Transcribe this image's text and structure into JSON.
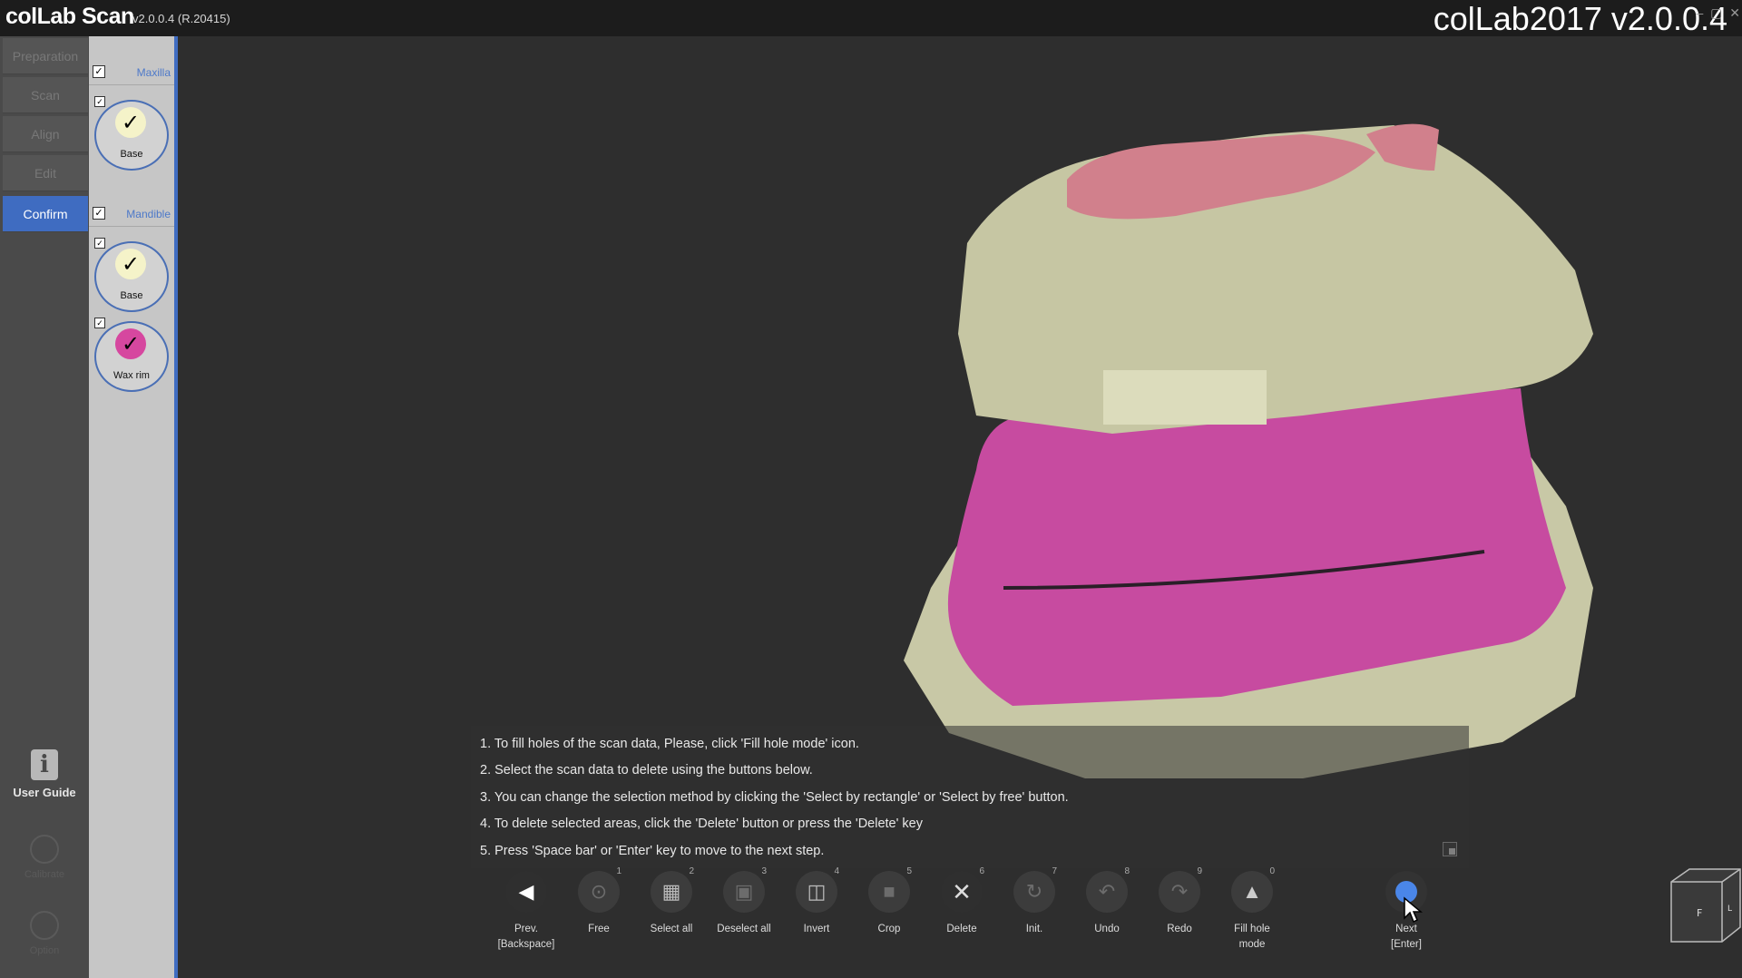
{
  "titlebar": {
    "app_name": "colLab Scan",
    "version": "v2.0.0.4 (R.20415)",
    "overlay_title": "colLab2017 v2.0.0.4",
    "controls": {
      "minimize": "–",
      "maximize": "▢",
      "close": "✕"
    }
  },
  "steps": [
    {
      "label": "Preparation",
      "state": "disabled"
    },
    {
      "label": "Scan",
      "state": "disabled"
    },
    {
      "label": "Align",
      "state": "disabled"
    },
    {
      "label": "Edit",
      "state": "disabled"
    },
    {
      "label": "Confirm",
      "state": "active"
    }
  ],
  "side_tools": {
    "user_guide": "User Guide",
    "calibrate": "Calibrate",
    "options": "Option"
  },
  "data_panel": {
    "maxilla": {
      "label": "Maxilla",
      "checked": true,
      "items": [
        {
          "label": "Base",
          "checked": true,
          "color": "#f5f3c9"
        }
      ]
    },
    "mandible": {
      "label": "Mandible",
      "checked": true,
      "items": [
        {
          "label": "Base",
          "checked": true,
          "color": "#f5f3c9"
        },
        {
          "label": "Wax rim",
          "checked": true,
          "color": "#d6479f"
        }
      ]
    }
  },
  "instructions": [
    "1. To fill holes of the scan data, Please, click 'Fill hole mode' icon.",
    "2. Select the scan data to delete using the buttons below.",
    "3. You can change the selection method by clicking the 'Select by rectangle' or 'Select by free' button.",
    "4. To delete selected areas, click the 'Delete' button or press the 'Delete' key",
    "5. Press 'Space bar' or 'Enter' key to move to the next step."
  ],
  "toolbar": {
    "prev": {
      "label1": "Prev.",
      "label2": "[Backspace]"
    },
    "tools": [
      {
        "label": "Free",
        "key": "1",
        "icon": "lasso-icon"
      },
      {
        "label": "Select all",
        "key": "2",
        "icon": "select-all-icon"
      },
      {
        "label": "Deselect all",
        "key": "3",
        "icon": "deselect-all-icon"
      },
      {
        "label": "Invert",
        "key": "4",
        "icon": "invert-icon"
      },
      {
        "label": "Crop",
        "key": "5",
        "icon": "crop-icon"
      },
      {
        "label": "Delete",
        "key": "6",
        "icon": "delete-icon"
      },
      {
        "label": "Init.",
        "key": "7",
        "icon": "init-icon"
      },
      {
        "label": "Undo",
        "key": "8",
        "icon": "undo-icon"
      },
      {
        "label": "Redo",
        "key": "9",
        "icon": "redo-icon"
      },
      {
        "label": "Fill hole\nmode",
        "key": "0",
        "icon": "fill-hole-icon"
      }
    ],
    "next": {
      "label1": "Next",
      "label2": "[Enter]"
    }
  },
  "viewcube": {
    "front": "F",
    "left": "L"
  },
  "colors": {
    "accent": "#3f6cc1",
    "model_cream": "#c9c9a8",
    "model_pink_wax": "#c9479f",
    "model_pink_top": "#d67d8c"
  }
}
